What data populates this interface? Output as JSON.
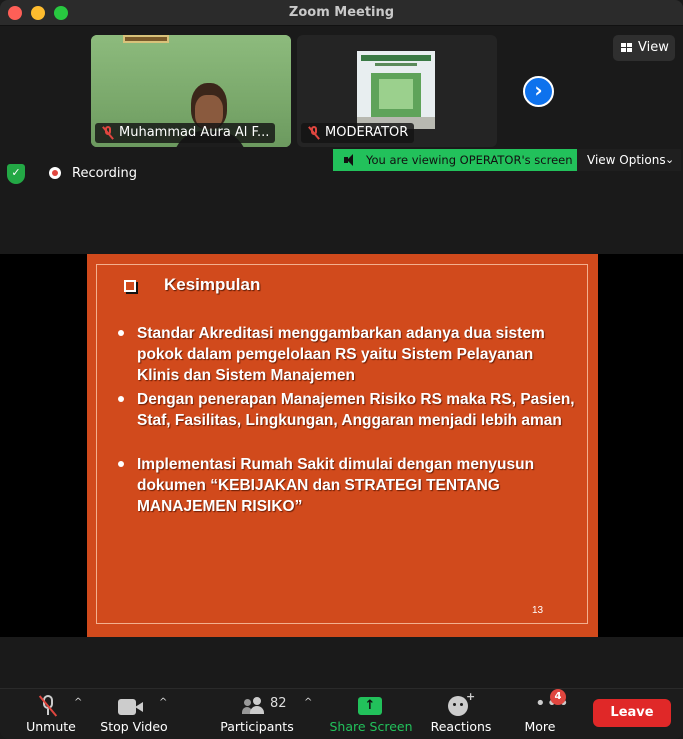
{
  "window": {
    "title": "Zoom Meeting"
  },
  "view_button": {
    "label": "View"
  },
  "participants_strip": [
    {
      "name": "Muhammad Aura Al F...",
      "muted": true
    },
    {
      "name": "MODERATOR",
      "muted": true
    }
  ],
  "status": {
    "recording_label": "Recording",
    "viewing_banner": "You are viewing OPERATOR's screen",
    "view_options": "View Options",
    "banner_color": "#22c15b"
  },
  "slide": {
    "heading": "Kesimpulan",
    "bullets": [
      "Standar Akreditasi  menggambarkan adanya dua sistem pokok dalam pemgelolaan RS yaitu  Sistem Pelayanan Klinis dan Sistem Manajemen",
      "Dengan penerapan Manajemen Risiko RS maka RS, Pasien, Staf, Fasilitas, Lingkungan, Anggaran menjadi lebih aman",
      "Implementasi Rumah Sakit dimulai dengan menyusun dokumen “KEBIJAKAN dan STRATEGI TENTANG MANAJEMEN RISIKO”"
    ],
    "page_number": "13",
    "background_color": "#d14a1c"
  },
  "toolbar": {
    "unmute": "Unmute",
    "stop_video": "Stop Video",
    "participants": "Participants",
    "participant_count": "82",
    "share_screen": "Share Screen",
    "reactions": "Reactions",
    "more": "More",
    "more_badge": "4",
    "leave": "Leave",
    "leave_color": "#e02828"
  }
}
